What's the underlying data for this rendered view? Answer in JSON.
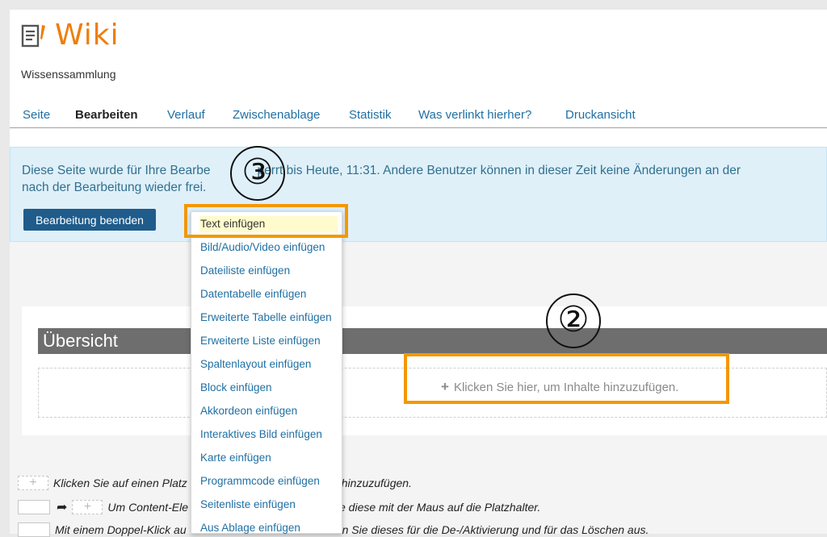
{
  "app": {
    "title": "Wiki",
    "subtitle": "Wissenssammlung"
  },
  "tabs": [
    {
      "label": "Seite"
    },
    {
      "label": "Bearbeiten",
      "active": true
    },
    {
      "label": "Verlauf"
    },
    {
      "label": "Zwischenablage"
    },
    {
      "label": "Statistik"
    },
    {
      "label": "Was verlinkt hierher?"
    },
    {
      "label": "Druckansicht"
    }
  ],
  "info": {
    "line1_a": "Diese Seite wurde für Ihre Bearbe",
    "line1_b": "perrt bis Heute, 11:31. Andere Benutzer können in dieser Zeit keine Änderungen an der",
    "line2": "nach der Bearbeitung wieder frei.",
    "end_button": "Bearbeitung beenden"
  },
  "section": {
    "title": "Übersicht",
    "add_content": "Klicken Sie hier, um Inhalte hinzuzufügen."
  },
  "menu": {
    "items": [
      "Text einfügen",
      "Bild/Audio/Video einfügen",
      "Dateiliste einfügen",
      "Datentabelle einfügen",
      "Erweiterte Tabelle einfügen",
      "Erweiterte Liste einfügen",
      "Spaltenlayout einfügen",
      "Block einfügen",
      "Akkordeon einfügen",
      "Interaktives Bild einfügen",
      "Karte einfügen",
      "Programmcode einfügen",
      "Seitenliste einfügen",
      "Aus Ablage einfügen"
    ]
  },
  "help": {
    "row1_a": "Klicken Sie auf einen Platz",
    "row1_b": "hinzuzufügen.",
    "row2_a": "Um Content-Ele",
    "row2_b": "e diese mit der Maus auf die Platzhalter.",
    "row3_a": "Mit einem Doppel-Klick au",
    "row3_b": "n Sie dieses für die De-/Aktivierung und für das Löschen aus."
  },
  "annotations": {
    "step2": "②",
    "step3": "③"
  },
  "colors": {
    "brand": "#ee7e0b",
    "link": "#1f6fa3",
    "highlight": "#f39800",
    "info_bg": "#dff0f9",
    "button": "#1f5c8b"
  }
}
